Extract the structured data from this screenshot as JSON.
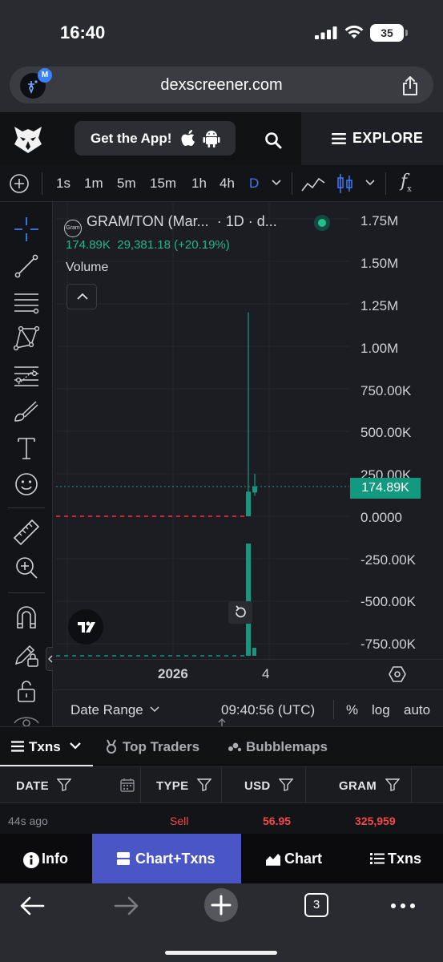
{
  "status_bar": {
    "time": "16:40",
    "battery": "35"
  },
  "browser": {
    "url": "dexscreener.com",
    "favicon_badge": "M"
  },
  "header": {
    "get_app_label": "Get the App!",
    "explore_label": "EXPLORE"
  },
  "toolbar": {
    "timeframes": [
      {
        "label": "1s"
      },
      {
        "label": "1m"
      },
      {
        "label": "5m"
      },
      {
        "label": "15m"
      },
      {
        "label": "1h"
      },
      {
        "label": "4h"
      },
      {
        "label": "D",
        "active": true
      }
    ],
    "fx_label": "f",
    "fx_sub": "x"
  },
  "chart": {
    "symbol": "GRAM/TON (Mar...",
    "interval": "· 1D · d...",
    "token_icon_text": "Gram",
    "ohlc_value": "174.89K",
    "change_text": "29,381.18 (+20.19%)",
    "volume_label": "Volume",
    "price_tag": "174.89K",
    "y_labels": [
      "1.75M",
      "1.50M",
      "1.25M",
      "1.00M",
      "750.00K",
      "500.00K",
      "250.00K",
      "0.0000",
      "-250.00K",
      "-500.00K",
      "-750.00K"
    ],
    "x_year": "2026",
    "x_day": "4",
    "accent_up": "#149981",
    "accent_down": "#f23645"
  },
  "chart_data": {
    "type": "candlestick",
    "ylim": [
      -820000,
      1800000
    ],
    "candles": [
      {
        "open": 0,
        "high": 1200000,
        "low": 0,
        "close": 145000
      },
      {
        "open": 140000,
        "high": 250000,
        "low": 120000,
        "close": 174890
      }
    ],
    "last_price": 174890,
    "y_ticks": [
      1750000,
      1500000,
      1250000,
      1000000,
      750000,
      500000,
      250000,
      0,
      -250000,
      -500000,
      -750000
    ]
  },
  "range_bar": {
    "date_range_label": "Date Range",
    "clock": "09:40:56 (UTC)",
    "percent": "%",
    "log": "log",
    "auto": "auto"
  },
  "txn_tabs": {
    "txns": "Txns",
    "top_traders": "Top Traders",
    "bubblemaps": "Bubblemaps"
  },
  "table": {
    "headers": [
      "DATE",
      "TYPE",
      "USD",
      "GRAM"
    ],
    "rows": [
      {
        "date": "44s ago",
        "type": "Sell",
        "usd": "56.95",
        "gram": "325,959"
      }
    ],
    "sell_color": "#f5474b"
  },
  "bottom_nav": {
    "info": "Info",
    "chart_txns": "Chart+Txns",
    "chart": "Chart",
    "txns": "Txns"
  },
  "safari": {
    "tab_count": "3"
  }
}
